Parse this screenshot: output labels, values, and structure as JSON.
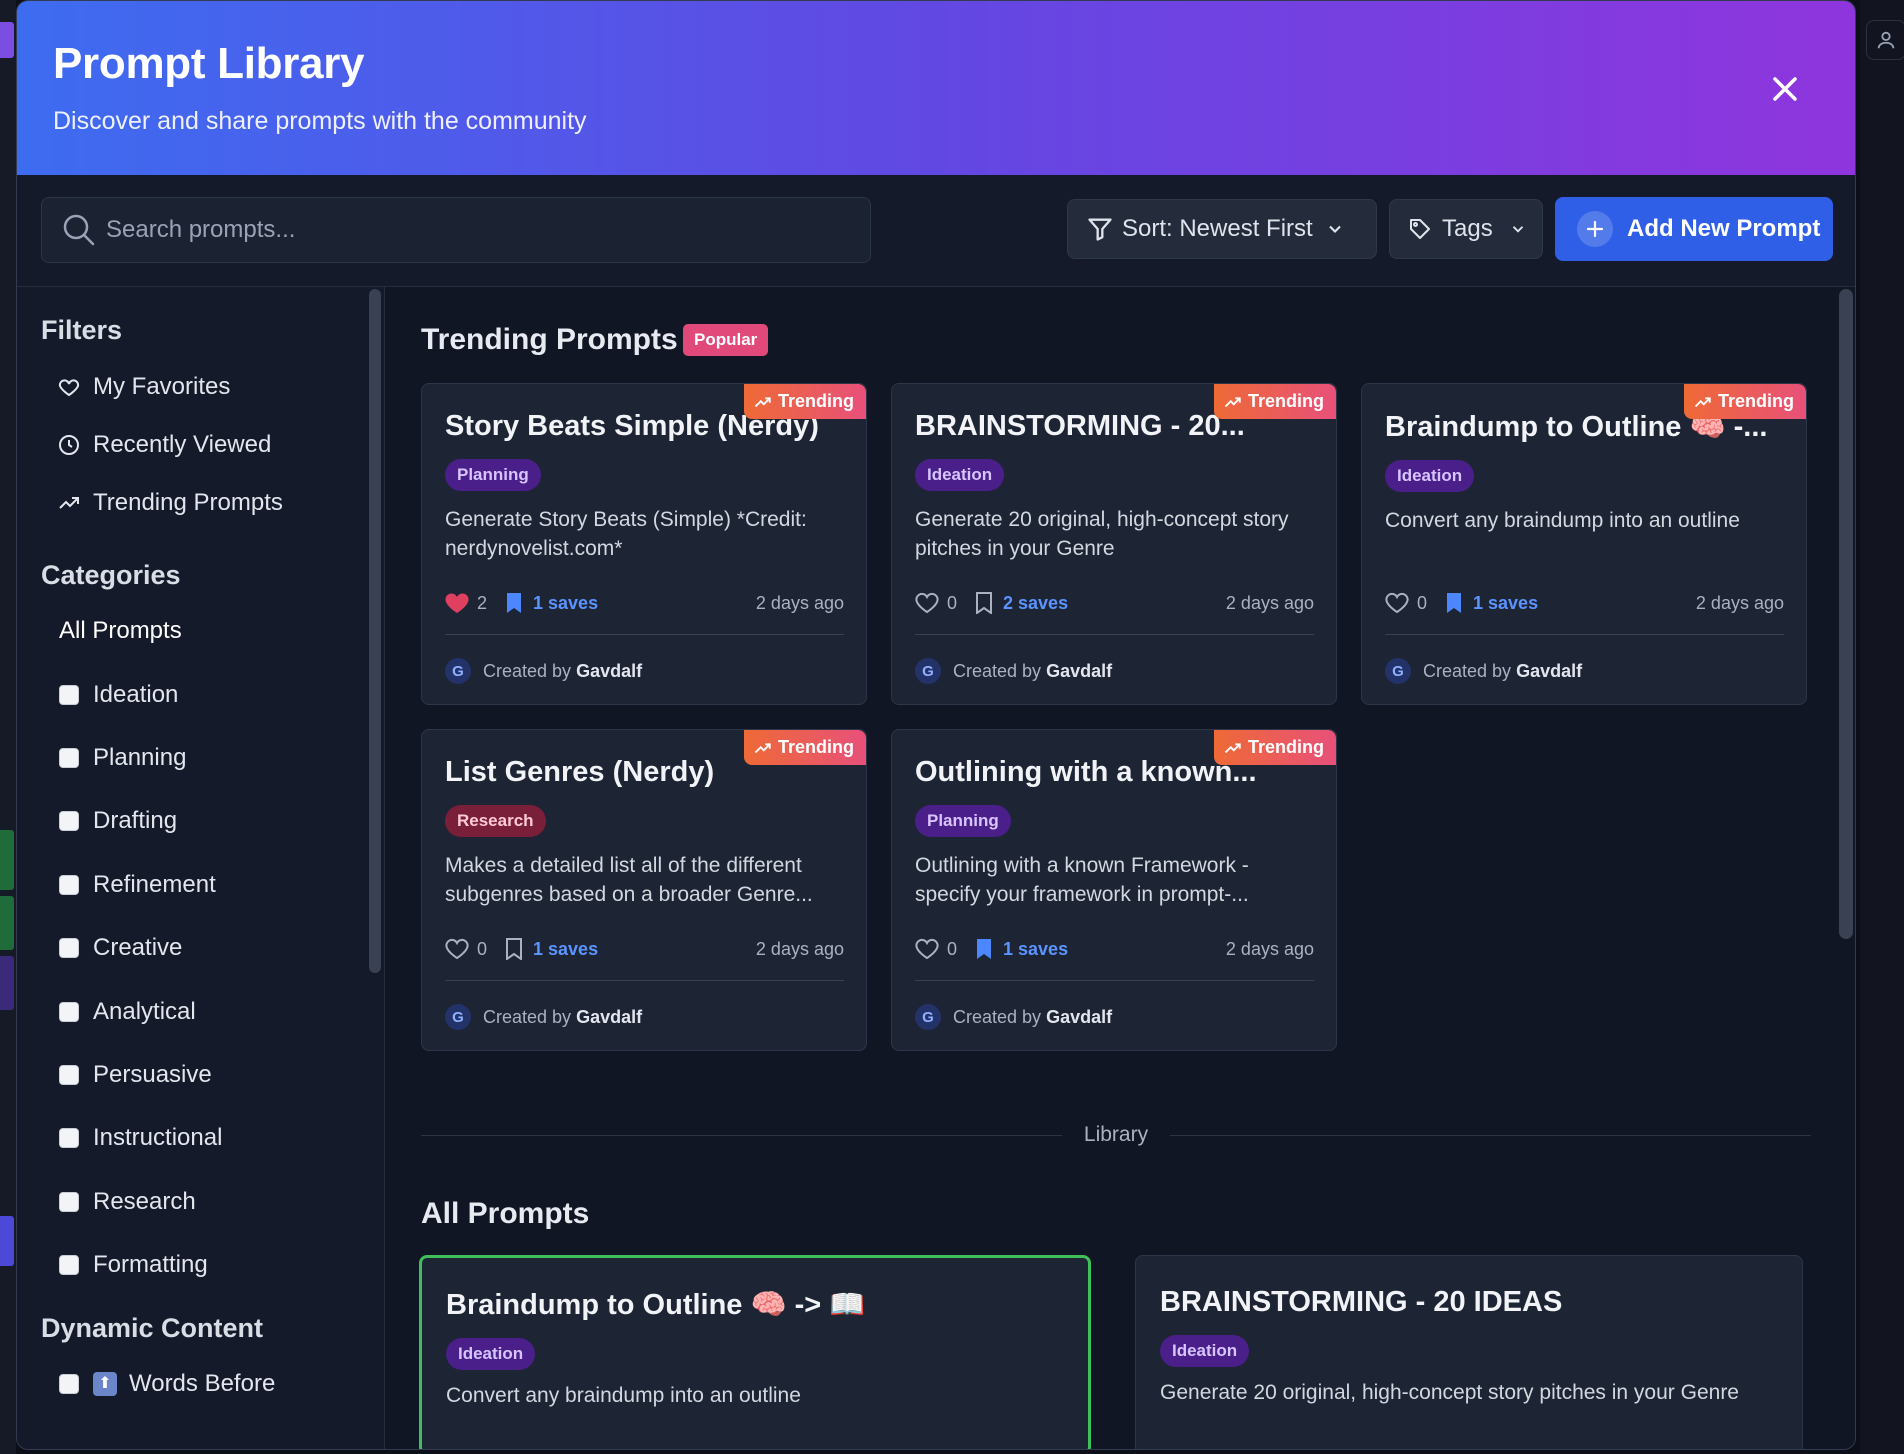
{
  "modal": {
    "title": "Prompt Library",
    "subtitle": "Discover and share prompts with the community"
  },
  "toolbar": {
    "search_placeholder": "Search prompts...",
    "sort_label": "Sort: Newest First",
    "tags_label": "Tags",
    "add_label": "Add New Prompt"
  },
  "sidebar": {
    "filters_heading": "Filters",
    "filters": [
      {
        "label": "My Favorites",
        "icon": "heart-icon"
      },
      {
        "label": "Recently Viewed",
        "icon": "clock-icon"
      },
      {
        "label": "Trending Prompts",
        "icon": "trending-icon"
      }
    ],
    "categories_heading": "Categories",
    "all_prompts": "All Prompts",
    "categories": [
      "Ideation",
      "Planning",
      "Drafting",
      "Refinement",
      "Creative",
      "Analytical",
      "Persuasive",
      "Instructional",
      "Research",
      "Formatting"
    ],
    "dynamic_heading": "Dynamic Content",
    "dynamic_items": [
      {
        "label": "Words Before",
        "icon": "arrow-up-emoji"
      }
    ]
  },
  "trending": {
    "title": "Trending Prompts",
    "badge": "Popular",
    "trend_label": "Trending",
    "cards": [
      {
        "title": "Story Beats Simple (Nerdy)",
        "tag": "Planning",
        "desc": "Generate Story Beats (Simple) *Credit: nerdynovelist.com*",
        "likes": "2",
        "liked": true,
        "saves": "1 saves",
        "saved": true,
        "when": "2 days ago",
        "author": "Gavdalf"
      },
      {
        "title": "BRAINSTORMING - 20...",
        "tag": "Ideation",
        "desc": "Generate 20 original, high-concept story pitches in your Genre",
        "likes": "0",
        "liked": false,
        "saves": "2 saves",
        "saved": false,
        "when": "2 days ago",
        "author": "Gavdalf"
      },
      {
        "title": "Braindump to Outline 🧠 -...",
        "tag": "Ideation",
        "desc": "Convert any braindump into an outline",
        "likes": "0",
        "liked": false,
        "saves": "1 saves",
        "saved": true,
        "when": "2 days ago",
        "author": "Gavdalf"
      },
      {
        "title": "List Genres (Nerdy)",
        "tag": "Research",
        "desc": "Makes a detailed list all of the different subgenres based on a broader Genre... (Credit: nerdynovelist.com)",
        "likes": "0",
        "liked": false,
        "saves": "1 saves",
        "saved": false,
        "when": "2 days ago",
        "author": "Gavdalf"
      },
      {
        "title": "Outlining with a known...",
        "tag": "Planning",
        "desc": "Outlining with a known Framework - specify your framework in prompt-... Credit: Nerdy Novelist: *Credit:",
        "likes": "0",
        "liked": false,
        "saves": "1 saves",
        "saved": true,
        "when": "2 days ago",
        "author": "Gavdalf"
      }
    ],
    "created_by": "Created by"
  },
  "library": {
    "divider_label": "Library",
    "title": "All Prompts",
    "cards": [
      {
        "title": "Braindump to Outline 🧠 -> 📖",
        "tag": "Ideation",
        "desc": "Convert any braindump into an outline"
      },
      {
        "title": "BRAINSTORMING - 20 IDEAS",
        "tag": "Ideation",
        "desc": "Generate 20 original, high-concept story pitches in your Genre"
      }
    ]
  },
  "colors": {
    "header_gradient": [
      "#3d6cf0",
      "#8f35dd"
    ],
    "primary": "#2f5fe6",
    "trending": "#ee6a36",
    "popular": "#e0497a",
    "selected_border": "#3fbf5a"
  }
}
